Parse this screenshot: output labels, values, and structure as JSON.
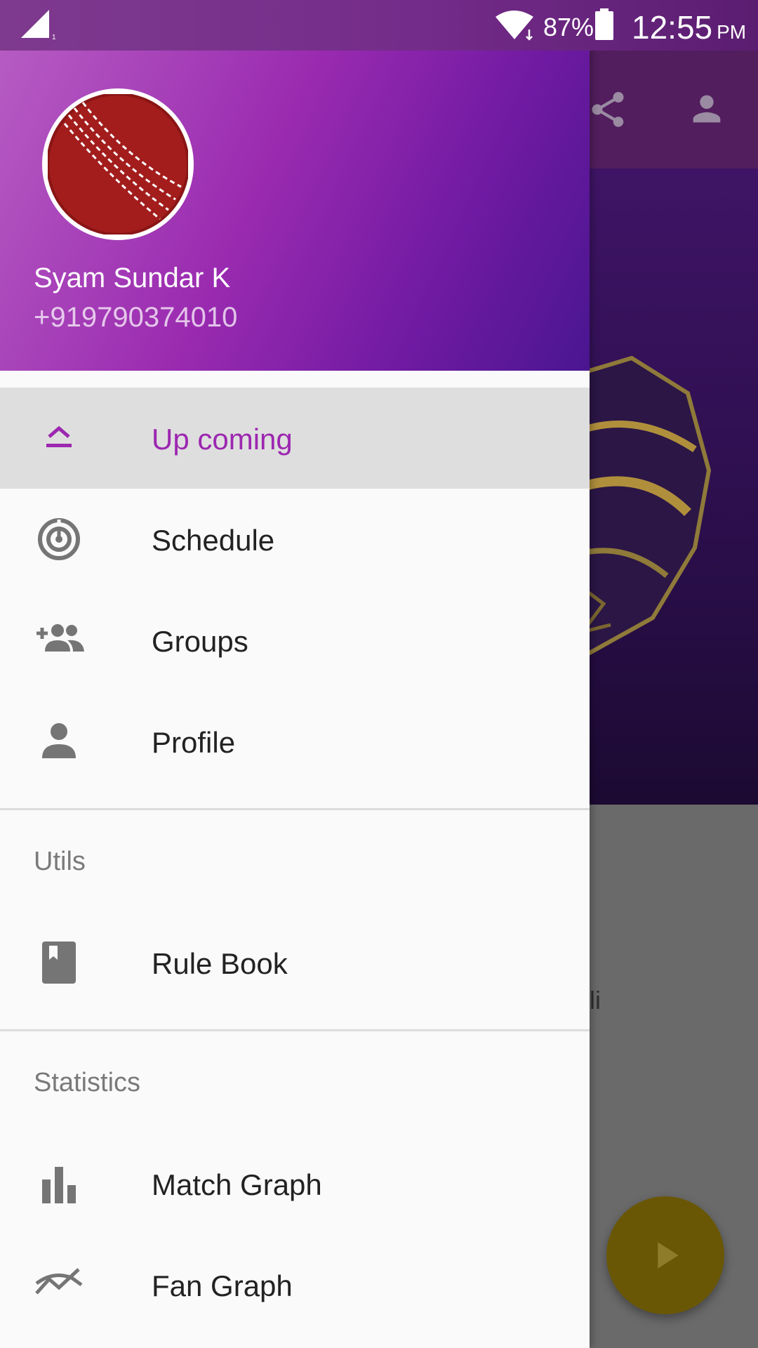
{
  "status_bar": {
    "battery_percent": "87%",
    "time": "12:55",
    "am_pm": "PM",
    "icons": [
      "signal-icon",
      "wifi-icon",
      "battery-icon"
    ]
  },
  "background_app": {
    "toolbar_icons": [
      "share-icon",
      "account-icon"
    ],
    "partial_text": "li",
    "fab_icon": "play-icon",
    "fab_color": "#6a5706"
  },
  "drawer": {
    "header": {
      "avatar_icon": "cricket-ball-icon",
      "user_name": "Syam Sundar K",
      "user_phone": "+919790374010"
    },
    "accent_color": "#9c27b0",
    "main_items": [
      {
        "label": "Up coming",
        "icon": "upcoming-icon",
        "active": true
      },
      {
        "label": "Schedule",
        "icon": "schedule-icon",
        "active": false
      },
      {
        "label": "Groups",
        "icon": "group-add-icon",
        "active": false
      },
      {
        "label": "Profile",
        "icon": "person-icon",
        "active": false
      }
    ],
    "utils": {
      "title": "Utils",
      "items": [
        {
          "label": "Rule Book",
          "icon": "book-icon"
        }
      ]
    },
    "statistics": {
      "title": "Statistics",
      "items": [
        {
          "label": "Match Graph",
          "icon": "bar-chart-icon"
        },
        {
          "label": "Fan Graph",
          "icon": "trend-graph-icon"
        }
      ]
    }
  }
}
